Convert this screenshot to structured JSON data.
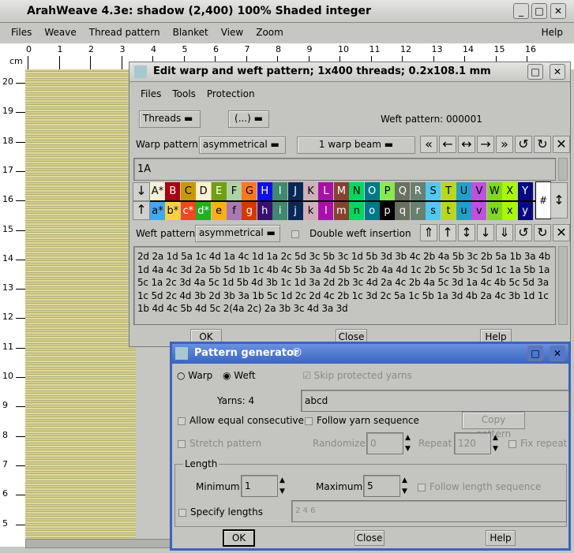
{
  "main": {
    "title": "ArahWeave 4.3e: shadow (2,400) 100% Shaded integer",
    "menu": [
      "Files",
      "Weave",
      "Thread pattern",
      "Blanket",
      "View",
      "Zoom"
    ],
    "help": "Help",
    "ruler_unit": "cm",
    "top_ticks": [
      "0",
      "1",
      "2",
      "3",
      "4",
      "5",
      "6",
      "7",
      "8",
      "9",
      "10",
      "11",
      "12",
      "13",
      "14",
      "15",
      "16"
    ],
    "left_ticks": [
      "20",
      "19",
      "18",
      "17",
      "16",
      "15",
      "14",
      "13",
      "12",
      "11",
      "10",
      "9",
      "8",
      "7",
      "6",
      "5"
    ]
  },
  "edit": {
    "title": "Edit warp and weft pattern; 1x400 threads; 0.2x108.1 mm",
    "menu": [
      "Files",
      "Tools",
      "Protection"
    ],
    "threads": "Threads",
    "ellipsis": "(...)",
    "weft_pattern_label": "Weft pattern: 000001",
    "warp_label": "Warp pattern",
    "warp_mode": "asymmetrical",
    "beam": "1 warp beam",
    "warp_text": "1A",
    "weft_label": "Weft pattern",
    "weft_mode": "asymmetrical",
    "double_weft": "Double weft insertion",
    "weft_text": "2d 2a 1d 5a 1c 4d 1a 4c 1d 1a 2c 5d 3c 5b 3c 1d 5b 3d 3b 4c 2b 4a 5b 3c 2b 5a 1b 3a 4b 1d 4a 4c 3d 2a 5b 5d 1b 1c 4b 4c 5b 3a 4d 5b 5c 2b 4a 4d 1c 2b 5c 5b 3c 5d 1c 1a 5b 1a 5c 1a 2c 3d 4a 5c 1d 5b 4d 3b 1c 1d 3a 2d 2b 3c 4d 2a 4c 2b 4a 5c 3d 1a 4c 4b 5c 5d 3a 1c 5d 2c 4d 3b 2d 3b 3a 1b 5c 1d 2c 2d 4c 2b 1c 3d 2c 5a 1c 5b 1a 3d 4b 2a 4c 3b 1d 1c 1b 4d 4c 5b 4d 5c 2(4a 2c) 2a 3b 3c 4d 3a 3d",
    "hash": "#",
    "ok": "OK",
    "close": "Close",
    "help": "Help",
    "warp_yarns": [
      [
        "A*",
        "#f5f0d8",
        "#000"
      ],
      [
        "B",
        "#a80010",
        "#fff"
      ],
      [
        "C",
        "#c89800",
        "#000"
      ],
      [
        "D",
        "#fff0d0",
        "#000"
      ],
      [
        "E",
        "#70a010",
        "#fff"
      ],
      [
        "F",
        "#b0d0a8",
        "#000"
      ],
      [
        "G",
        "#ff7820",
        "#000"
      ],
      [
        "H",
        "#1010e8",
        "#fff"
      ],
      [
        "I",
        "#408870",
        "#fff"
      ],
      [
        "J",
        "#082858",
        "#fff"
      ],
      [
        "K",
        "#d0b0b8",
        "#000"
      ],
      [
        "L",
        "#a810a8",
        "#fff"
      ],
      [
        "M",
        "#884030",
        "#fff"
      ],
      [
        "N",
        "#00d860",
        "#000"
      ],
      [
        "O",
        "#007888",
        "#fff"
      ],
      [
        "P",
        "#88e850",
        "#000"
      ],
      [
        "Q",
        "#687060",
        "#fff"
      ],
      [
        "R",
        "#688070",
        "#fff"
      ],
      [
        "S",
        "#50c8f0",
        "#000"
      ],
      [
        "T",
        "#b8d820",
        "#000"
      ],
      [
        "U",
        "#20a0c8",
        "#000"
      ],
      [
        "V",
        "#c050e0",
        "#000"
      ],
      [
        "W",
        "#80d820",
        "#000"
      ],
      [
        "X",
        "#a8f800",
        "#000"
      ],
      [
        "Y",
        "#080880",
        "#fff"
      ]
    ],
    "weft_yarns": [
      [
        "a*",
        "#40a8f0",
        "#000"
      ],
      [
        "b*",
        "#f8d040",
        "#000"
      ],
      [
        "c*",
        "#f04820",
        "#fff"
      ],
      [
        "d*",
        "#20b020",
        "#fff"
      ],
      [
        "e",
        "#f8b018",
        "#000"
      ],
      [
        "f",
        "#a878b0",
        "#000"
      ],
      [
        "g",
        "#d83800",
        "#fff"
      ],
      [
        "h",
        "#381070",
        "#fff"
      ],
      [
        "i",
        "#408870",
        "#fff"
      ],
      [
        "j",
        "#082858",
        "#fff"
      ],
      [
        "k",
        "#d0b0b8",
        "#000"
      ],
      [
        "l",
        "#a810a8",
        "#fff"
      ],
      [
        "m",
        "#884030",
        "#fff"
      ],
      [
        "n",
        "#00d860",
        "#000"
      ],
      [
        "o",
        "#007888",
        "#fff"
      ],
      [
        "p",
        "#000000",
        "#fff"
      ],
      [
        "q",
        "#687060",
        "#fff"
      ],
      [
        "r",
        "#688070",
        "#fff"
      ],
      [
        "s",
        "#50c8f0",
        "#000"
      ],
      [
        "t",
        "#b8d820",
        "#000"
      ],
      [
        "u",
        "#20a0c8",
        "#000"
      ],
      [
        "v",
        "#c050e0",
        "#000"
      ],
      [
        "w",
        "#80d820",
        "#000"
      ],
      [
        "x",
        "#a8f800",
        "#000"
      ],
      [
        "y",
        "#080880",
        "#fff"
      ]
    ]
  },
  "gen": {
    "title": "Pattern generator",
    "warp": "Warp",
    "weft": "Weft",
    "selected": "Weft",
    "skip": "Skip protected yarns",
    "skip_checked": true,
    "yarns": "Yarns: 4",
    "yarn_value": "abcd",
    "allow_equal": "Allow equal consecutive",
    "follow_yarn": "Follow yarn sequence",
    "copy": "Copy pattern",
    "stretch": "Stretch pattern",
    "randomize": "Randomize",
    "randomize_value": "0",
    "repeat": "Repeat",
    "repeat_value": "120",
    "fix_repeat": "Fix repeat",
    "length": "Length",
    "minimum": "Minimum",
    "min_value": "1",
    "maximum": "Maximum",
    "max_value": "5",
    "follow_length": "Follow length sequence",
    "specify": "Specify lengths",
    "lengths_value": "2 4 6",
    "ok": "OK",
    "close": "Close",
    "help": "Help",
    "accent": "#3a64c0"
  }
}
